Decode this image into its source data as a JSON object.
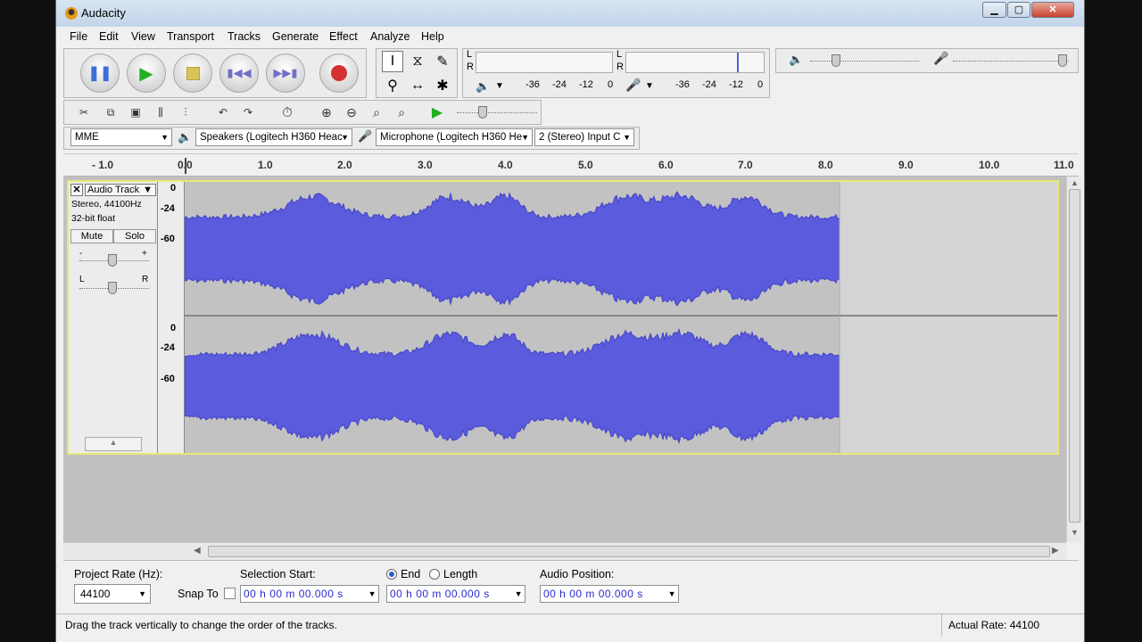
{
  "window": {
    "title": "Audacity"
  },
  "menu": [
    "File",
    "Edit",
    "View",
    "Transport",
    "Tracks",
    "Generate",
    "Effect",
    "Analyze",
    "Help"
  ],
  "meters": {
    "playback_scale": [
      "-36",
      "-24",
      "-12",
      "0"
    ],
    "record_scale": [
      "-36",
      "-24",
      "-12",
      "0"
    ],
    "left": "L",
    "right": "R"
  },
  "device": {
    "host": "MME",
    "speakers": "Speakers (Logitech H360 Heac",
    "microphone": "Microphone (Logitech H360 He",
    "channels": "2 (Stereo) Input C"
  },
  "ruler": {
    "ticks": [
      "- 1.0",
      "0.0",
      "1.0",
      "2.0",
      "3.0",
      "4.0",
      "5.0",
      "6.0",
      "7.0",
      "8.0",
      "9.0",
      "10.0",
      "11.0"
    ]
  },
  "track": {
    "name": "Audio Track",
    "info1": "Stereo, 44100Hz",
    "info2": "32-bit float",
    "mute": "Mute",
    "solo": "Solo",
    "gain_minus": "-",
    "gain_plus": "+",
    "pan_left": "L",
    "pan_right": "R",
    "vruler_top": [
      "0",
      "-24",
      "-60"
    ],
    "vruler_bottom": [
      "0",
      "-24",
      "-60"
    ],
    "audio_end_seconds": 8.15,
    "wave_color": "#5b5bde"
  },
  "selection": {
    "project_rate_label": "Project Rate (Hz):",
    "project_rate": "44100",
    "snap_to": "Snap To",
    "selection_start_label": "Selection Start:",
    "end_label": "End",
    "length_label": "Length",
    "audio_position_label": "Audio Position:",
    "start_value": "00 h 00 m 00.000 s",
    "end_value": "00 h 00 m 00.000 s",
    "position_value": "00 h 00 m 00.000 s"
  },
  "status": {
    "message": "Drag the track vertically to change the order of the tracks.",
    "actual_rate": "Actual Rate: 44100"
  }
}
